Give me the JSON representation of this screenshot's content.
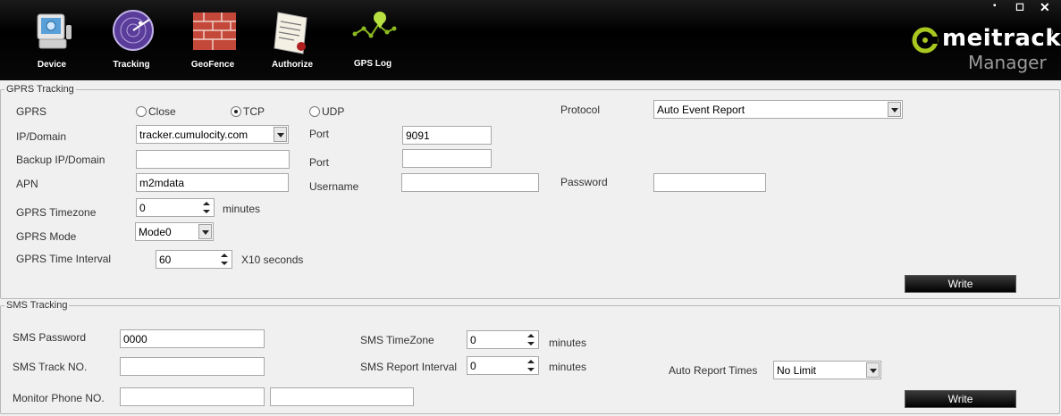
{
  "toolbar": {
    "items": [
      {
        "label": "Device",
        "icon": "monitor-icon"
      },
      {
        "label": "Tracking",
        "icon": "radar-icon"
      },
      {
        "label": "GeoFence",
        "icon": "brick-wall-icon"
      },
      {
        "label": "Authorize",
        "icon": "certificate-icon"
      },
      {
        "label": "GPS Log",
        "icon": "gps-path-icon"
      }
    ],
    "window_controls": {
      "minimize": "▪",
      "maximize": "◻",
      "close": "✕"
    }
  },
  "logo": {
    "brand": "meitrack",
    "sub": "Manager",
    "reg": "®",
    "accent": "#a8c820"
  },
  "gprs": {
    "title": "GPRS Tracking",
    "gprs_label": "GPRS",
    "radio_close": "Close",
    "radio_tcp": "TCP",
    "radio_udp": "UDP",
    "selected": "TCP",
    "protocol_label": "Protocol",
    "protocol_value": "Auto Event Report",
    "ip_label": "IP/Domain",
    "ip_value": "tracker.cumulocity.com",
    "port_label": "Port",
    "port_value": "9091",
    "backup_label": "Backup IP/Domain",
    "backup_value": "",
    "backup_port_label": "Port",
    "backup_port_value": "",
    "apn_label": "APN",
    "apn_value": "m2mdata",
    "username_label": "Username",
    "username_value": "",
    "password_label": "Password",
    "password_value": "",
    "timezone_label": "GPRS Timezone",
    "timezone_value": "0",
    "timezone_unit": "minutes",
    "mode_label": "GPRS Mode",
    "mode_value": "Mode0",
    "interval_label": "GPRS Time Interval",
    "interval_value": "60",
    "interval_unit": "X10 seconds",
    "write_label": "Write"
  },
  "sms": {
    "title": "SMS Tracking",
    "password_label": "SMS Password",
    "password_value": "0000",
    "track_label": "SMS Track NO.",
    "track_value": "",
    "monitor_label": "Monitor Phone NO.",
    "monitor_value_1": "",
    "monitor_value_2": "",
    "timezone_label": "SMS TimeZone",
    "timezone_value": "0",
    "timezone_unit": "minutes",
    "report_label": "SMS Report Interval",
    "report_value": "0",
    "report_unit": "minutes",
    "auto_label": "Auto Report Times",
    "auto_value": "No Limit",
    "write_label": "Write"
  }
}
